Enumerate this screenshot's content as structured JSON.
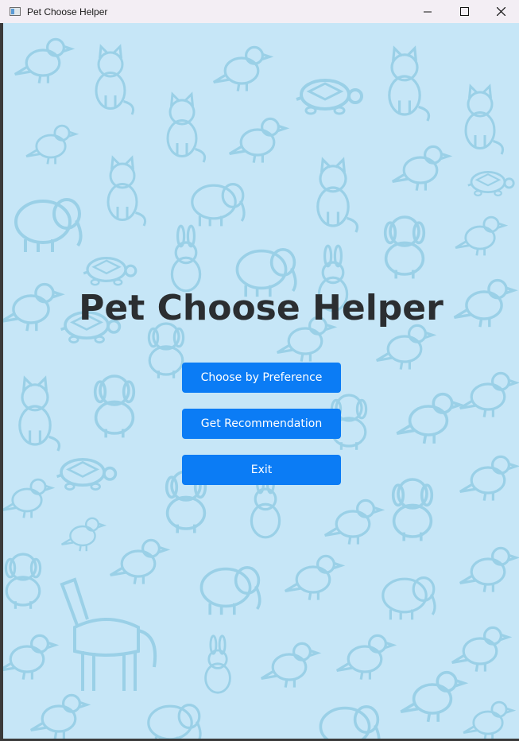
{
  "window": {
    "title": "Pet Choose Helper",
    "icons": {
      "app": "app-window-icon",
      "minimize": "minimize-icon",
      "maximize": "maximize-icon",
      "close": "close-icon"
    }
  },
  "main": {
    "heading": "Pet Choose Helper",
    "buttons": {
      "preference": "Choose by Preference",
      "recommendation": "Get Recommendation",
      "exit": "Exit"
    }
  },
  "colors": {
    "background": "#c6e6f7",
    "pattern": "#8fcbe3",
    "button": "#0b7cf5",
    "heading": "#2b2e31"
  }
}
